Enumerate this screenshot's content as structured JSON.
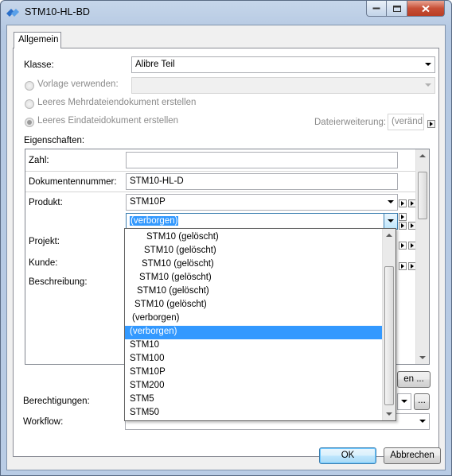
{
  "window": {
    "title": "STM10-HL-BD"
  },
  "tabs": [
    {
      "label": "Allgemein"
    }
  ],
  "form": {
    "klasse_label": "Klasse:",
    "klasse_value": "Alibre Teil",
    "vorlage_label": "Vorlage verwenden:",
    "mehrdatei_label": "Leeres Mehrdateiendokument erstellen",
    "eindatei_label": "Leeres Eindateidokument erstellen",
    "dateierweiterung_label": "Dateierweiterung:",
    "dateierweiterung_value": "(veränd",
    "eigenschaften_label": "Eigenschaften:",
    "berechtigungen_label": "Berechtigungen:",
    "workflow_label": "Workflow:"
  },
  "properties": {
    "zahl_label": "Zahl:",
    "zahl_value": "",
    "dokumentennummer_label": "Dokumentennummer:",
    "dokumentennummer_value": "STM10-HL-D",
    "produkt_label": "Produkt:",
    "produkt_value": "STM10P",
    "sub_value": "(verborgen)",
    "projekt_label": "Projekt:",
    "kunde_label": "Kunde:",
    "beschreibung_label": "Beschreibung:",
    "button_partial": "en ..."
  },
  "dropdown": {
    "items": [
      {
        "label": "STM10 (gelöscht)"
      },
      {
        "label": "STM10 (gelöscht)"
      },
      {
        "label": "STM10 (gelöscht)"
      },
      {
        "label": "STM10 (gelöscht)"
      },
      {
        "label": "STM10 (gelöscht)"
      },
      {
        "label": "STM10 (gelöscht)"
      },
      {
        "label": "(verborgen)"
      },
      {
        "label": "(verborgen)"
      },
      {
        "label": "STM10"
      },
      {
        "label": "STM100"
      },
      {
        "label": "STM10P"
      },
      {
        "label": "STM200"
      },
      {
        "label": "STM5"
      },
      {
        "label": "STM50"
      }
    ],
    "selected_index": 7
  },
  "buttons": {
    "ok": "OK",
    "cancel": "Abbrechen",
    "ellipsis": "..."
  },
  "colors": {
    "selection": "#3399ff",
    "titlebar": "#b9cce5"
  }
}
